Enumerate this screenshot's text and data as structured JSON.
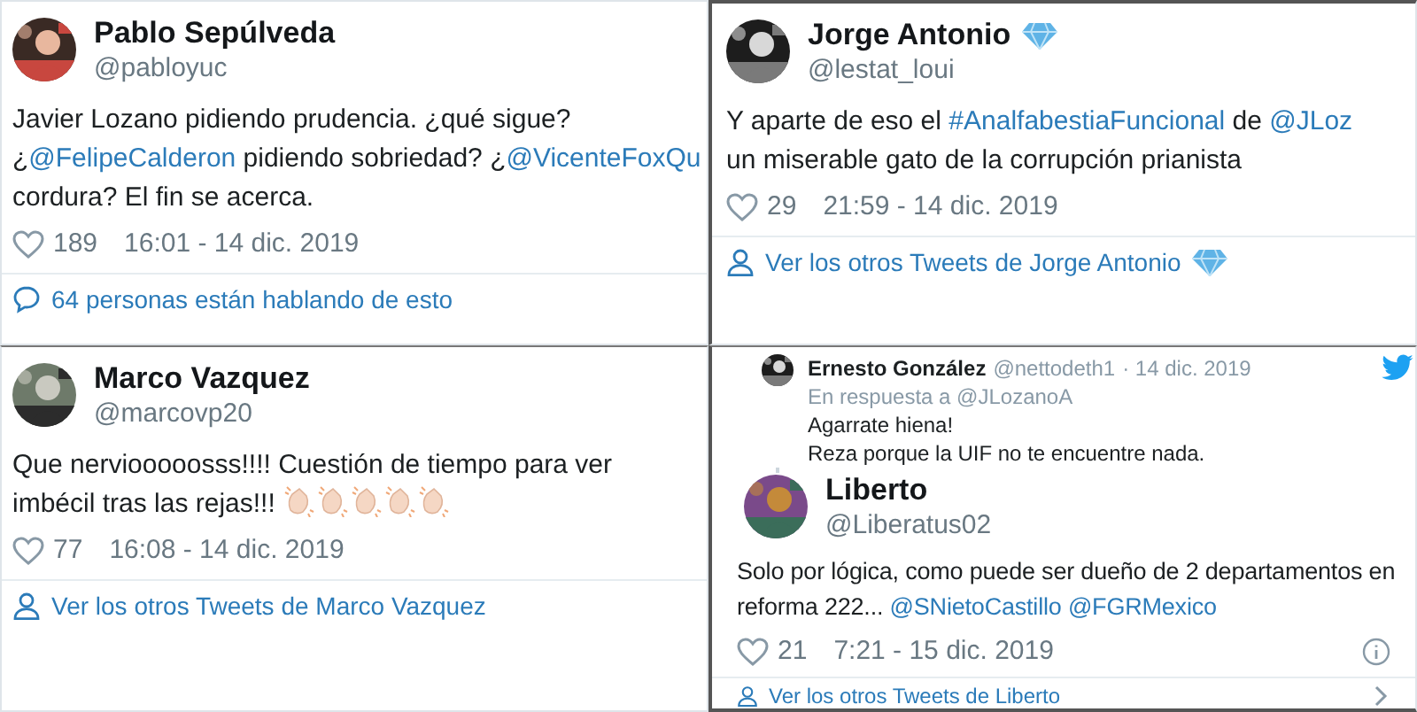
{
  "tweets": [
    {
      "name": "Pablo Sepúlveda",
      "handle": "@pabloyuc",
      "avatar": {
        "kind": "picture"
      },
      "body": [
        [
          {
            "kind": "text",
            "text": "Javier Lozano pidiendo prudencia. ¿qué sigue?"
          }
        ],
        [
          {
            "kind": "text",
            "text": "¿"
          },
          {
            "kind": "mention",
            "text": "@FelipeCalderon"
          },
          {
            "kind": "text",
            "text": " pidiendo sobriedad? ¿"
          },
          {
            "kind": "mention",
            "text": "@VicenteFoxQu"
          }
        ],
        [
          {
            "kind": "text",
            "text": "cordura? El fin se acerca."
          }
        ]
      ],
      "likes": "189",
      "timestamp": "16:01 - 14 dic. 2019",
      "footer": {
        "kind": "conversation",
        "text": "64 personas están hablando de esto"
      }
    },
    {
      "name": "Jorge Antonio",
      "handle": "@lestat_loui",
      "badge": {
        "kind": "diamond"
      },
      "avatar": {
        "kind": "picture"
      },
      "body": [
        [
          {
            "kind": "text",
            "text": "Y aparte de eso el "
          },
          {
            "kind": "hashtag",
            "text": "#AnalfabestiaFuncional"
          },
          {
            "kind": "text",
            "text": " de "
          },
          {
            "kind": "mention",
            "text": "@JLoz"
          }
        ],
        [
          {
            "kind": "text",
            "text": "un miserable gato de la corrupción prianista"
          }
        ]
      ],
      "likes": "29",
      "timestamp": "21:59 - 14 dic. 2019",
      "footer": {
        "kind": "profile",
        "text": "Ver los otros Tweets de Jorge Antonio",
        "badge": {
          "kind": "diamond"
        }
      }
    },
    {
      "name": "Marco Vazquez",
      "handle": "@marcovp20",
      "avatar": {
        "kind": "picture"
      },
      "body": [
        [
          {
            "kind": "text",
            "text": "Que nerviooooosss!!!! Cuestión de tiempo para ver"
          }
        ],
        [
          {
            "kind": "text",
            "text": "imbécil tras las rejas!!! "
          },
          {
            "kind": "clap"
          },
          {
            "kind": "clap"
          },
          {
            "kind": "clap"
          },
          {
            "kind": "clap"
          },
          {
            "kind": "clap"
          }
        ]
      ],
      "likes": "77",
      "timestamp": "16:08 - 14 dic. 2019",
      "footer": {
        "kind": "profile",
        "text": "Ver los otros Tweets de Marco Vazquez"
      }
    },
    {
      "reply_to": {
        "name": "Ernesto González",
        "handle": "@nettodeth1",
        "date": "· 14 dic. 2019",
        "context_label": "En respuesta a",
        "context_handle": "@JLozanoA",
        "lines": [
          "Agarrate hiena!",
          "Reza porque la UIF no te encuentre nada."
        ]
      },
      "name": "Liberto",
      "handle": "@Liberatus02",
      "avatar": {
        "kind": "picture"
      },
      "body": [
        [
          {
            "kind": "text",
            "text": "Solo por lógica, como puede ser dueño de 2 departamentos en"
          }
        ],
        [
          {
            "kind": "text",
            "text": "reforma 222... "
          },
          {
            "kind": "mention",
            "text": "@SNietoCastillo"
          },
          {
            "kind": "space"
          },
          {
            "kind": "mention",
            "text": "@FGRMexico"
          }
        ]
      ],
      "likes": "21",
      "timestamp": "7:21 - 15 dic. 2019",
      "info": true,
      "footer": {
        "kind": "profile",
        "text": "Ver los otros Tweets de Liberto",
        "chevron": true
      }
    }
  ]
}
